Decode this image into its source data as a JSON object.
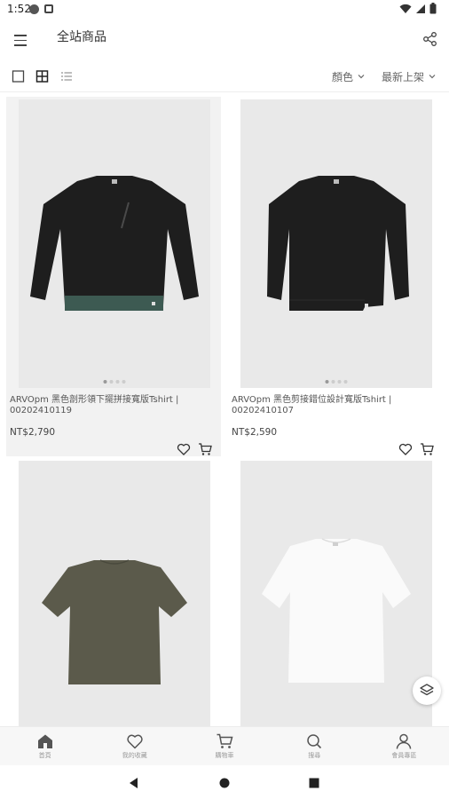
{
  "status_bar": {
    "time": "1:52"
  },
  "app_bar": {
    "title": "全站商品"
  },
  "toolbar": {
    "filter_color": "顏色",
    "sort": "最新上架"
  },
  "products": [
    {
      "name": "ARVOpm 黑色剖形領下擺拼接寬版Tshirt | 00202410119",
      "price": "NT$2,790",
      "color": "#1e1e1e"
    },
    {
      "name": "ARVOpm 黑色剪接錯位設計寬版Tshirt | 00202410107",
      "price": "NT$2,590",
      "color": "#1e1e1e"
    },
    {
      "name": "",
      "price": "",
      "color": "#5b5a4b"
    },
    {
      "name": "",
      "price": "",
      "color": "#fafafa"
    }
  ],
  "bottom_nav": [
    {
      "label": "首頁",
      "icon": "home-icon"
    },
    {
      "label": "我的收藏",
      "icon": "heart-icon"
    },
    {
      "label": "購物車",
      "icon": "cart-icon"
    },
    {
      "label": "搜尋",
      "icon": "search-icon"
    },
    {
      "label": "會員專區",
      "icon": "user-icon"
    }
  ]
}
